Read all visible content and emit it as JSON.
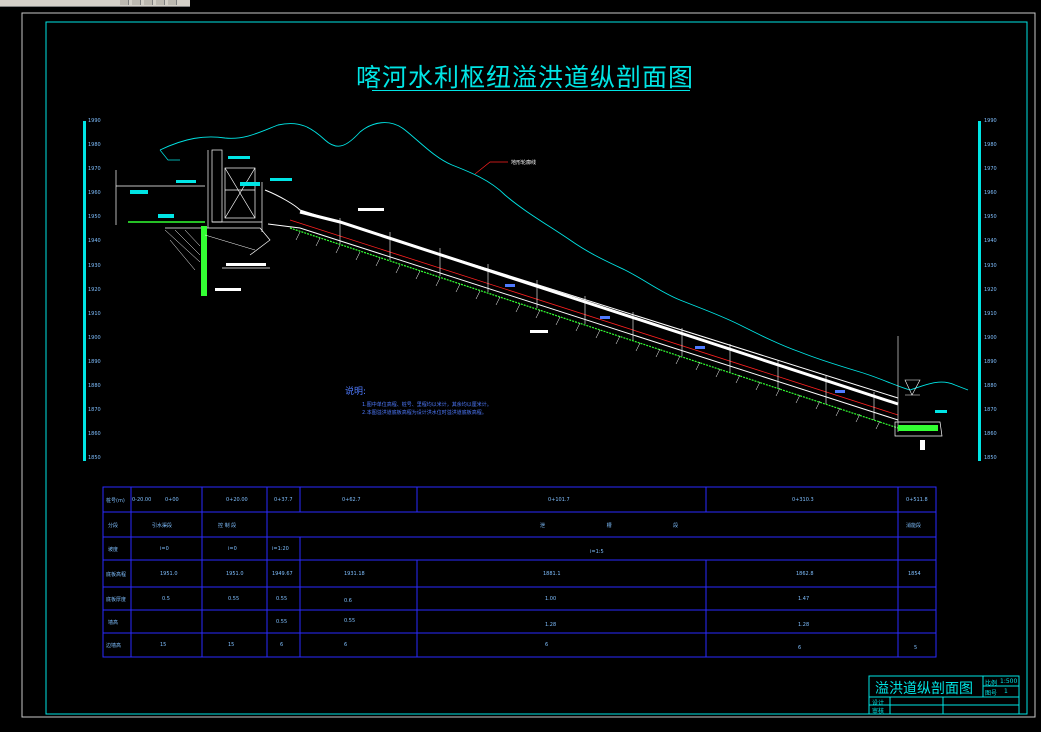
{
  "drawing": {
    "title": "喀河水利枢纽溢洪道纵剖面图",
    "terrain_label": "地形轮廓线",
    "notes_heading": "说明:",
    "notes": [
      "1.图中单位高程、桩号、里程均以米计，其余均以厘米计。",
      "2.本图溢洪道底板高程为设计洪水位时溢洪道底板高程。"
    ]
  },
  "elevation_axis": {
    "ticks": [
      "1990",
      "1980",
      "1970",
      "1960",
      "1950",
      "1940",
      "1930",
      "1920",
      "1910",
      "1900",
      "1890",
      "1880",
      "1870",
      "1860",
      "1850"
    ]
  },
  "table": {
    "rows": [
      {
        "label": "桩号(m)",
        "cells": [
          "0-20.00",
          "0+00",
          "0+20.00",
          "0+37.7",
          "0+62.7",
          "0+101.7",
          "0+310.3",
          "0+511.8"
        ]
      },
      {
        "label": "分段",
        "cells": [
          "引水渠段",
          "控 制 段",
          "泄 槽 段",
          "消能段"
        ]
      },
      {
        "label": "坡度",
        "cells": [
          "i=0",
          "i=0",
          "i=1:20",
          "i=1:5"
        ]
      },
      {
        "label": "底板高程",
        "cells": [
          "1951.0",
          "1951.0",
          "1949.67",
          "1931.18",
          "1881.1",
          "1862.8",
          "1854"
        ]
      },
      {
        "label": "底板厚度",
        "cells": [
          "0.5",
          "0.55",
          "0.55",
          "0.6",
          "1.00",
          "1.47"
        ]
      },
      {
        "label": "墙高",
        "cells": [
          "0.55",
          "0.55",
          "1.28",
          "1.28"
        ]
      },
      {
        "label": "边墙高",
        "cells": [
          "15",
          "15",
          "6",
          "6",
          "6",
          "6",
          "5"
        ]
      }
    ]
  },
  "title_block": {
    "name": "溢洪道纵剖面图",
    "scale_label": "比例",
    "scale_value": "1:500",
    "sheet_label": "图号",
    "sheet_value": "1",
    "design_label": "设计",
    "check_label": "审核"
  },
  "colors": {
    "frame": "#00e5e5",
    "terrain": "#00e5e5",
    "table": "#2a2aff",
    "structure": "#ffffff",
    "rock": "#33ff33",
    "waterline": "#ff2020"
  }
}
